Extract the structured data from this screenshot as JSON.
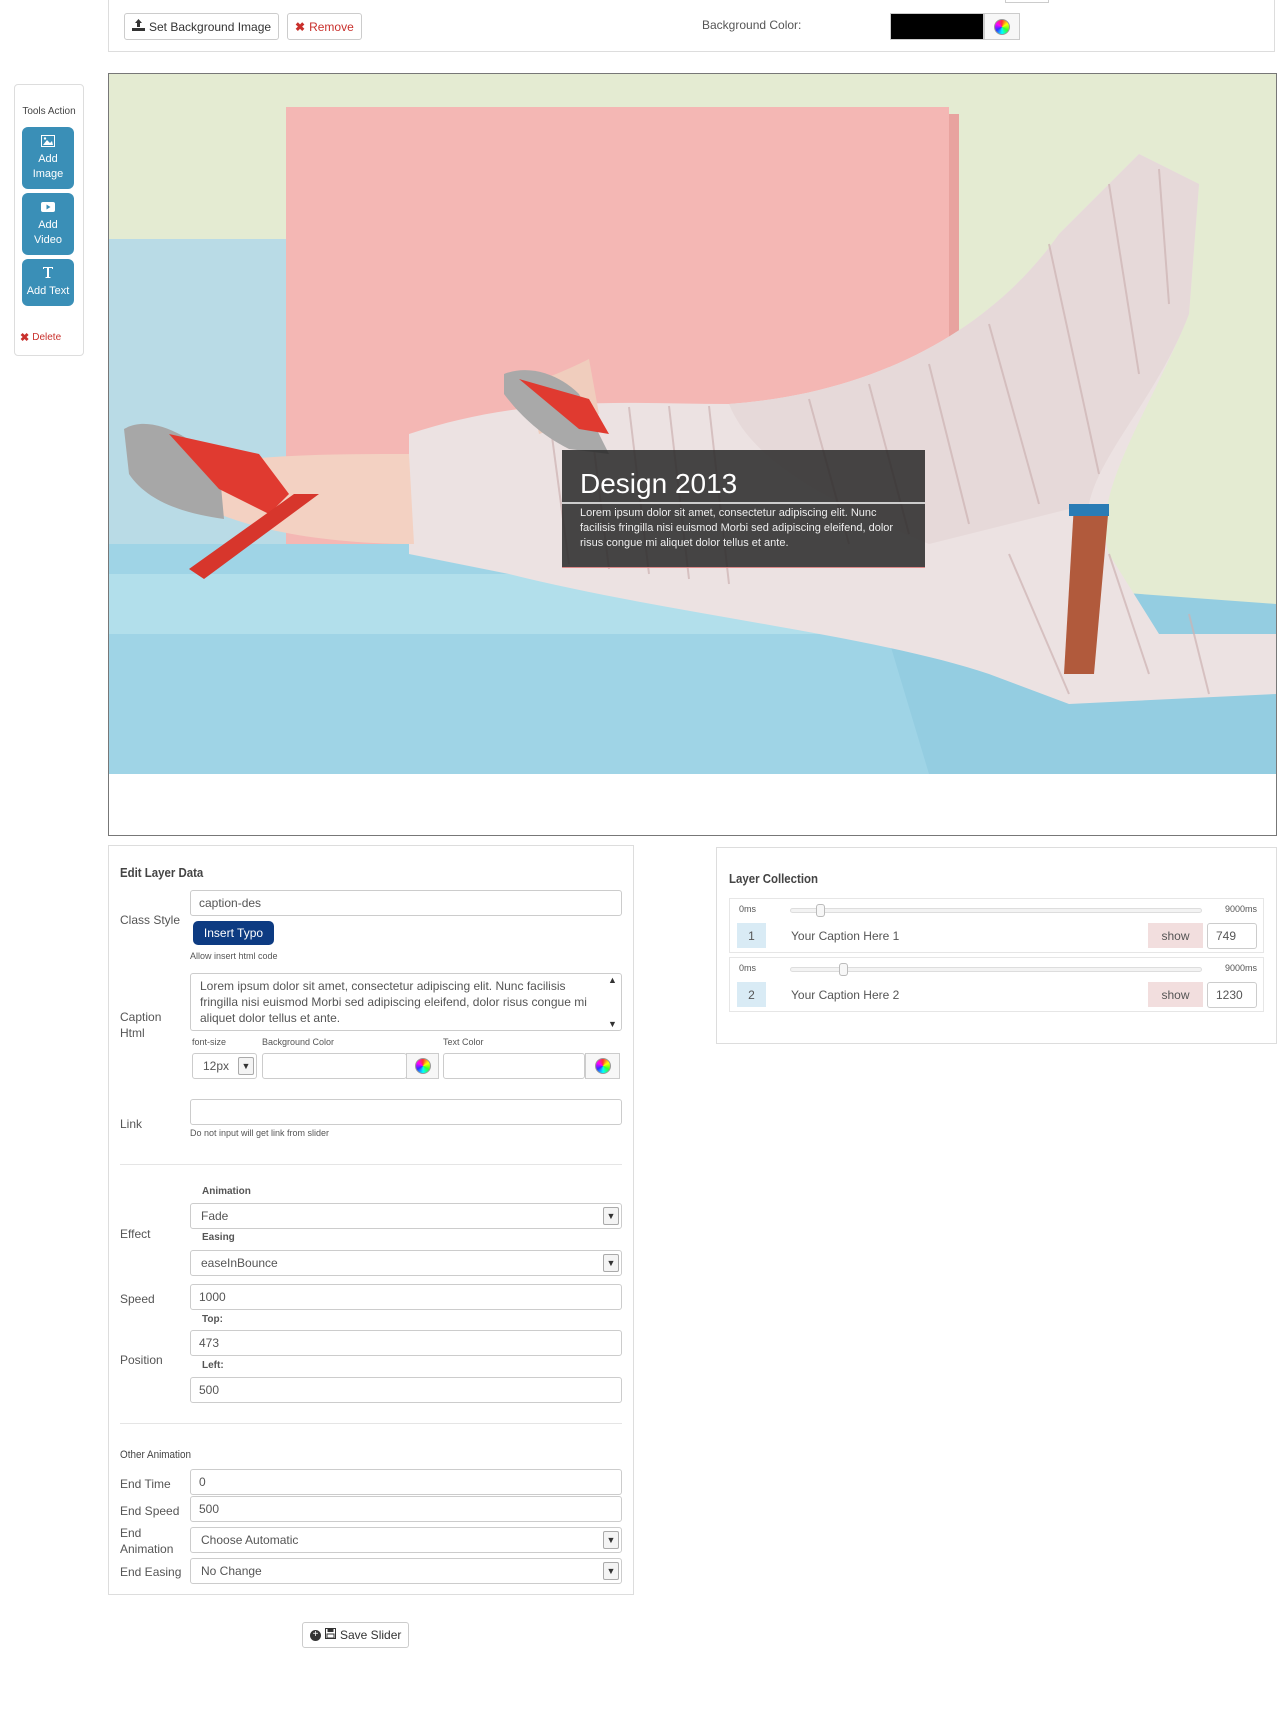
{
  "topbar": {
    "set_bg_label": "Set Background Image",
    "remove_label": "Remove",
    "bg_color_label": "Background Color:",
    "bg_color_value": "#000000"
  },
  "tools": {
    "title": "Tools Action",
    "add_image": "Add Image",
    "add_video": "Add Video",
    "add_text": "Add Text",
    "delete": "Delete"
  },
  "canvas": {
    "caption_title": "Design 2013",
    "caption_text": "Lorem ipsum dolor sit amet, consectetur adipiscing elit. Nunc facilisis fringilla nisi euismod Morbi sed adipiscing eleifend, dolor risus congue mi aliquet dolor tellus et ante."
  },
  "edit_layer": {
    "title": "Edit Layer Data",
    "class_style_label": "Class Style",
    "class_style_value": "caption-des",
    "insert_typo": "Insert Typo",
    "allow_html_note": "Allow insert html code",
    "caption_html_label": "Caption Html",
    "caption_html_value": "Lorem ipsum dolor sit amet, consectetur adipiscing elit. Nunc facilisis fringilla nisi euismod Morbi sed adipiscing eleifend, dolor risus congue mi aliquet dolor tellus et ante.",
    "font_size_label": "font-size",
    "font_size_value": "12px",
    "bg_color_label": "Background Color",
    "text_color_label": "Text Color",
    "link_label": "Link",
    "link_note": "Do not input will get link from slider",
    "effect_label": "Effect",
    "animation_label": "Animation",
    "animation_value": "Fade",
    "easing_label": "Easing",
    "easing_value": "easeInBounce",
    "speed_label": "Speed",
    "speed_value": "1000",
    "position_label": "Position",
    "top_label": "Top:",
    "top_value": "473",
    "left_label": "Left:",
    "left_value": "500",
    "other_anim_title": "Other Animation",
    "end_time_label": "End Time",
    "end_time_value": "0",
    "end_speed_label": "End Speed",
    "end_speed_value": "500",
    "end_anim_label": "End Animation",
    "end_anim_value": "Choose Automatic",
    "end_easing_label": "End Easing",
    "end_easing_value": "No Change"
  },
  "layer_collection": {
    "title": "Layer Collection",
    "layers": [
      {
        "min": "0ms",
        "max": "9000ms",
        "index": "1",
        "name": "Your Caption Here 1",
        "show": "show",
        "time": "749",
        "slider_fraction": 0.074
      },
      {
        "min": "0ms",
        "max": "9000ms",
        "index": "2",
        "name": "Your Caption Here 2",
        "show": "show",
        "time": "1230",
        "slider_fraction": 0.129
      }
    ]
  },
  "save_label": "Save Slider"
}
